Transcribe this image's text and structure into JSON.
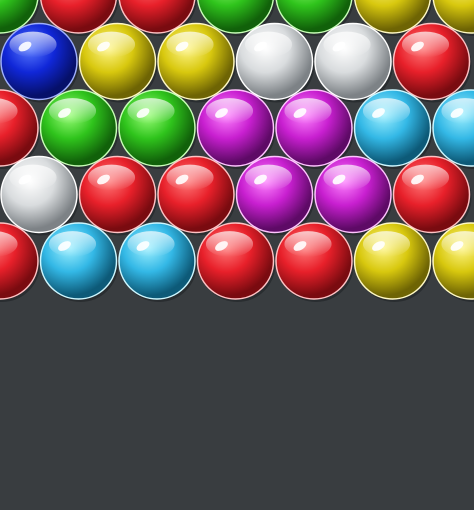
{
  "game": {
    "palette": {
      "red": {
        "light": "#ff7a7a",
        "base": "#e8202a",
        "dark": "#7a0b10",
        "rim": "#ffc2c4"
      },
      "blue": {
        "light": "#5a7bff",
        "base": "#1027d8",
        "dark": "#06106a",
        "rim": "#9fb0ff"
      },
      "yellow": {
        "light": "#fff68a",
        "base": "#d8c80e",
        "dark": "#6e6404",
        "rim": "#fff9c4"
      },
      "green": {
        "light": "#9cff7a",
        "base": "#2fc41c",
        "dark": "#11610a",
        "rim": "#c9ffb8"
      },
      "white": {
        "light": "#ffffff",
        "base": "#d9dcde",
        "dark": "#7d8286",
        "rim": "#ffffff"
      },
      "magenta": {
        "light": "#ff86ff",
        "base": "#c81fd0",
        "dark": "#5e0a66",
        "rim": "#ffc4ff"
      },
      "cyan": {
        "light": "#9ff0ff",
        "base": "#33b8e6",
        "dark": "#0d5a78",
        "rim": "#cdf7ff"
      }
    },
    "rows": [
      [
        "green",
        "red",
        "red",
        "green",
        "green",
        "yellow",
        "yellow"
      ],
      [
        "blue",
        "yellow",
        "yellow",
        "white",
        "white",
        "red"
      ],
      [
        "red",
        "green",
        "green",
        "magenta",
        "magenta",
        "cyan",
        "cyan"
      ],
      [
        "white",
        "red",
        "red",
        "magenta",
        "magenta",
        "red"
      ],
      [
        "red",
        "cyan",
        "cyan",
        "red",
        "red",
        "yellow",
        "yellow"
      ]
    ]
  }
}
